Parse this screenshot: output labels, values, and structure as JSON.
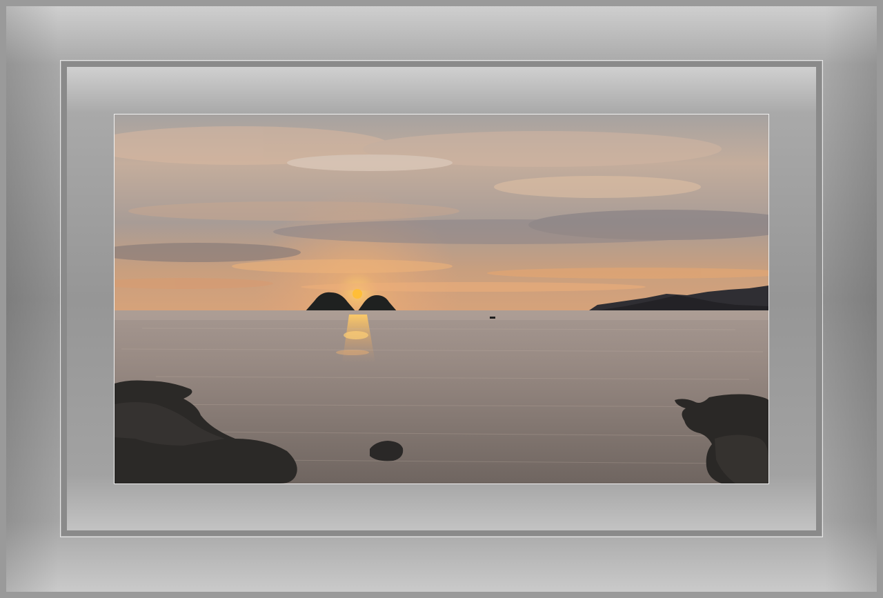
{
  "image": {
    "subject": "sunset-seascape",
    "frame_style": "double-gray-mat"
  },
  "colors": {
    "sky_top": "#9fa1a5",
    "sky_mid": "#c9a88d",
    "sky_horizon": "#e0a46c",
    "sun": "#ffb02e",
    "sea": "#9b8e86",
    "rock": "#2c2a29",
    "mat_light": "#d0d0d0",
    "mat_dark": "#8a8a8a"
  }
}
